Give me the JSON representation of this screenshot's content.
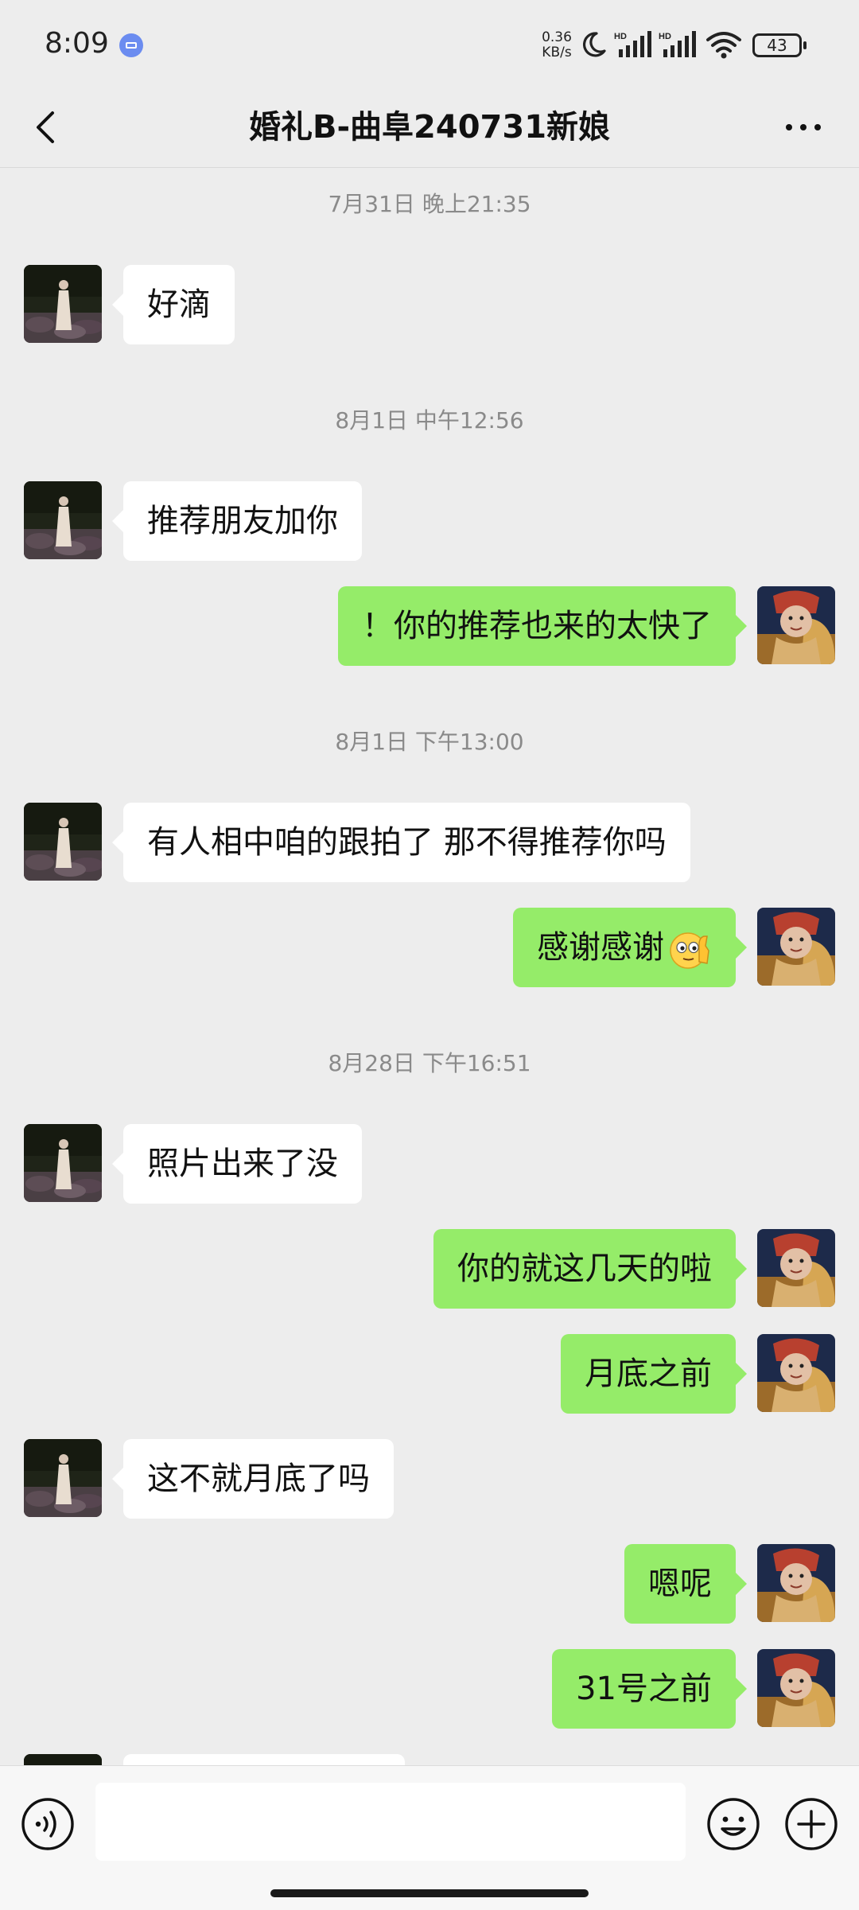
{
  "status_bar": {
    "time": "8:09",
    "net_speed": "0.36",
    "net_unit": "KB/s",
    "battery": "43",
    "icons": [
      "app-notification-icon",
      "moon-icon",
      "signal-hd-icon",
      "signal-hd-icon",
      "wifi-icon",
      "battery-icon"
    ]
  },
  "header": {
    "title": "婚礼B-曲阜240731新娘",
    "back_icon": "chevron-left-icon",
    "more_icon": "more-dots-icon"
  },
  "messages": {
    "ts1": "7月31日 晚上21:35",
    "m1": "好滴",
    "ts2": "8月1日 中午12:56",
    "m2": "推荐朋友加你",
    "m3": "！你的推荐也来的太快了",
    "ts3": "8月1日 下午13:00",
    "m4": "有人相中咱的跟拍了  那不得推荐你吗",
    "m5": "感谢感谢",
    "ts4": "8月28日 下午16:51",
    "m6": "照片出来了没",
    "m7": "你的就这几天的啦",
    "m8": "月底之前",
    "m9": "这不就月底了吗",
    "m10": "嗯呢",
    "m11": "31号之前"
  },
  "input_bar": {
    "placeholder": "",
    "icons": [
      "voice-icon",
      "emoji-icon",
      "plus-icon"
    ]
  },
  "colors": {
    "background": "#ededed",
    "sent_bubble": "#95ec69",
    "received_bubble": "#ffffff",
    "timestamp_text": "#8a8a8a"
  }
}
